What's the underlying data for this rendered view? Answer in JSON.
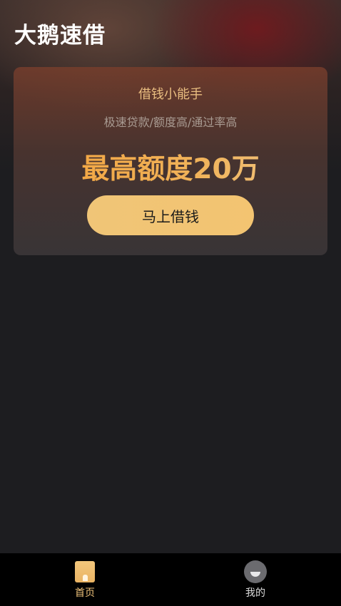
{
  "app": {
    "title": "大鹅速借"
  },
  "hero_card": {
    "heading": "借钱小能手",
    "subheading": "极速贷款/额度高/通过率高",
    "limit_text": "最高额度20万",
    "borrow_button_label": "马上借钱"
  },
  "tab_bar": {
    "items": [
      {
        "label": "首页",
        "icon": "home-icon",
        "active": true
      },
      {
        "label": "我的",
        "icon": "profile-icon",
        "active": false
      }
    ]
  },
  "colors": {
    "accent_gold": "#f0c577",
    "limit_orange": "#f5a63a",
    "background": "#1d1d20",
    "tab_bar": "#000000"
  }
}
